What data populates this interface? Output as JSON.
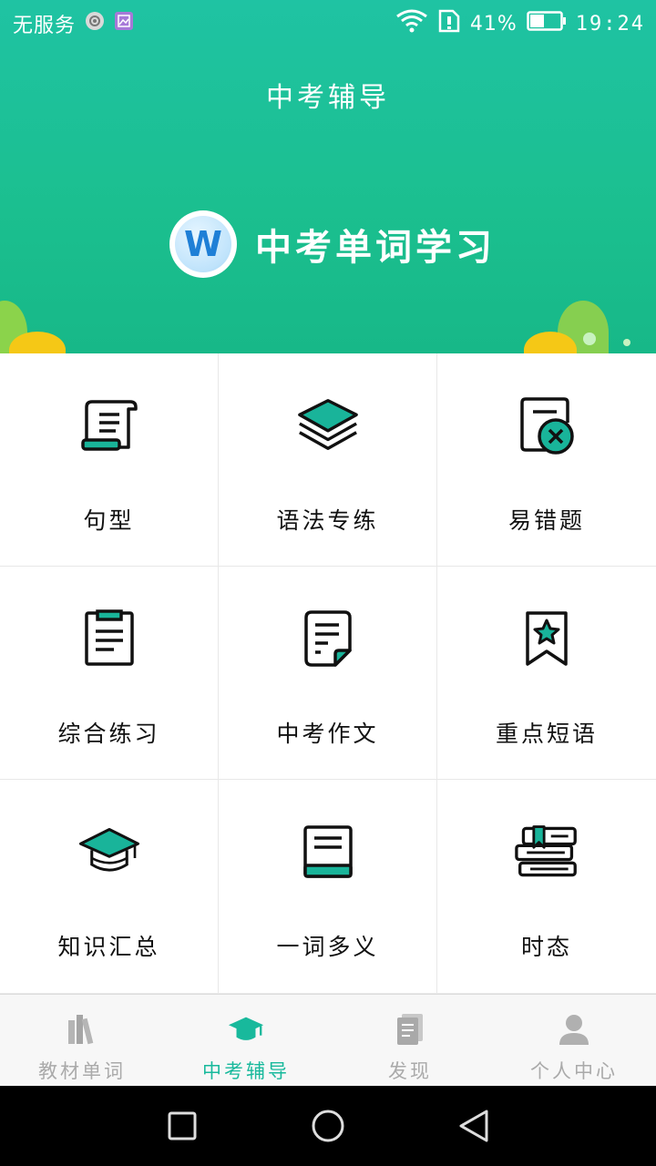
{
  "status_bar": {
    "carrier": "无服务",
    "battery": "41%",
    "time": "19:24"
  },
  "header": {
    "title": "中考辅导"
  },
  "banner": {
    "logo_letter": "W",
    "text": "中考单词学习"
  },
  "grid": {
    "items": [
      {
        "label": "句型",
        "icon": "scroll-icon"
      },
      {
        "label": "语法专练",
        "icon": "layers-icon"
      },
      {
        "label": "易错题",
        "icon": "error-document-icon"
      },
      {
        "label": "综合练习",
        "icon": "clipboard-icon"
      },
      {
        "label": "中考作文",
        "icon": "document-icon"
      },
      {
        "label": "重点短语",
        "icon": "bookmark-star-icon"
      },
      {
        "label": "知识汇总",
        "icon": "graduation-cap-icon"
      },
      {
        "label": "一词多义",
        "icon": "book-icon"
      },
      {
        "label": "时态",
        "icon": "book-stack-icon"
      }
    ]
  },
  "tabbar": {
    "tabs": [
      {
        "label": "教材单词",
        "icon": "books-icon",
        "active": false
      },
      {
        "label": "中考辅导",
        "icon": "graduation-cap-icon",
        "active": true
      },
      {
        "label": "发现",
        "icon": "news-icon",
        "active": false
      },
      {
        "label": "个人中心",
        "icon": "person-icon",
        "active": false
      }
    ]
  },
  "colors": {
    "primary": "#1bbf9c",
    "accent_teal": "#19b49a",
    "active_tab": "#18b99c",
    "inactive_tab": "#aaaaaa"
  }
}
